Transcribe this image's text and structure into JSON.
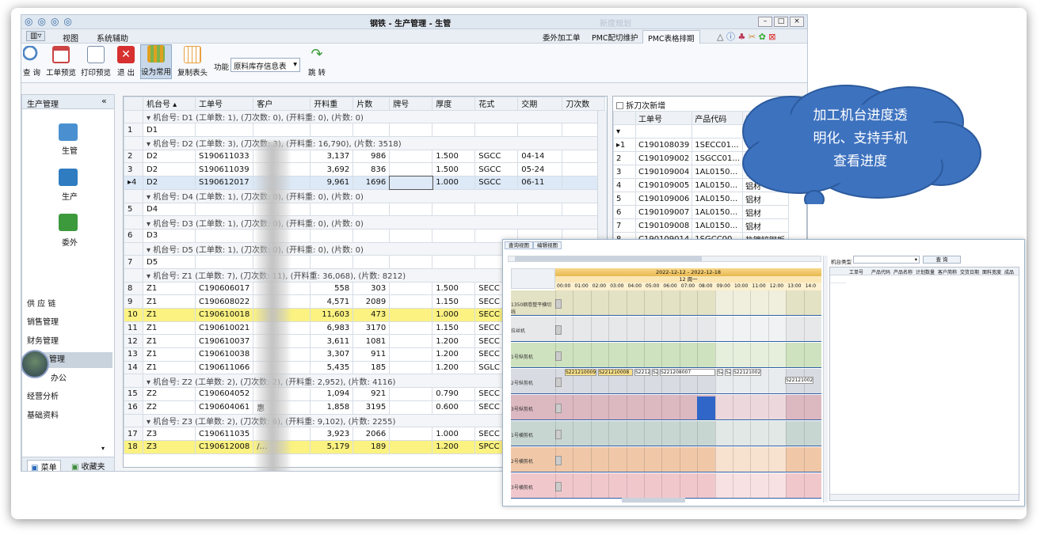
{
  "window": {
    "title": "钢铁 - 生产管理 - 生管",
    "faded_title": "新度规划"
  },
  "menu": {
    "items": [
      "视图",
      "系统辅助"
    ],
    "tabs": [
      "委外加工单",
      "PMC配切维护",
      "PMC表格排期"
    ],
    "active_tab": "PMC表格排期"
  },
  "ribbon": {
    "buttons": [
      "查 询",
      "工单预览",
      "打印预览",
      "退 出",
      "设为常用",
      "复制表头"
    ],
    "function_label": "功能",
    "function_value": "原料库存信息表",
    "jump_label": "跳 转"
  },
  "leftnav": {
    "header": "生产管理",
    "modules": [
      "生管",
      "生产",
      "委外"
    ],
    "items": [
      "供 应 链",
      "销售管理",
      "财务管理",
      "管理",
      "办公",
      "经营分析",
      "基础资料"
    ],
    "bottom_tabs": [
      "菜单",
      "收藏夹"
    ]
  },
  "grid": {
    "columns": [
      "机台号",
      "工单号",
      "客户",
      "开料重",
      "片数",
      "牌号",
      "厚度",
      "花式",
      "交期",
      "刀次数"
    ],
    "rows": [
      {
        "type": "group",
        "text": "机台号: D1 (工单数: 1), (刀次数: 0), (开料重: 0), (片数: 0)"
      },
      {
        "type": "row",
        "n": "1",
        "cells": [
          "D1",
          "",
          "",
          "",
          "",
          "",
          "",
          "",
          "",
          ""
        ]
      },
      {
        "type": "group",
        "text": "机台号: D2 (工单数: 3), (刀次数: 3), (开料重: 16,790), (片数: 3518)"
      },
      {
        "type": "row",
        "n": "2",
        "cells": [
          "D2",
          "S190611033",
          "",
          "3,137",
          "986",
          "",
          "1.500",
          "SGCC",
          "04-14",
          ""
        ]
      },
      {
        "type": "row",
        "n": "3",
        "cells": [
          "D2",
          "S190611039",
          "",
          "3,692",
          "836",
          "",
          "1.500",
          "SGCC",
          "05-24",
          ""
        ]
      },
      {
        "type": "sel",
        "n": "4",
        "cells": [
          "D2",
          "S190612017",
          "",
          "9,961",
          "1696",
          "",
          "1.000",
          "SGCC",
          "06-11",
          ""
        ]
      },
      {
        "type": "group",
        "text": "机台号: D4 (工单数: 1), (刀次数: 0), (开料重: 0), (片数: 0)"
      },
      {
        "type": "row",
        "n": "5",
        "cells": [
          "D4",
          "",
          "",
          "",
          "",
          "",
          "",
          "",
          "",
          ""
        ]
      },
      {
        "type": "group",
        "text": "机台号: D3 (工单数: 1), (刀次数: 0), (开料重: 0), (片数: 0)"
      },
      {
        "type": "row",
        "n": "6",
        "cells": [
          "D3",
          "",
          "",
          "",
          "",
          "",
          "",
          "",
          "",
          ""
        ]
      },
      {
        "type": "group",
        "text": "机台号: D5 (工单数: 1), (刀次数: 0), (开料重: 0), (片数: 0)"
      },
      {
        "type": "row",
        "n": "7",
        "cells": [
          "D5",
          "",
          "",
          "",
          "",
          "",
          "",
          "",
          "",
          ""
        ]
      },
      {
        "type": "group",
        "text": "机台号: Z1 (工单数: 7), (刀次数: 11), (开料重: 36,068), (片数: 8212)"
      },
      {
        "type": "row",
        "n": "8",
        "cells": [
          "Z1",
          "C190606017",
          "",
          "558",
          "303",
          "",
          "1.500",
          "SECC",
          "",
          ""
        ]
      },
      {
        "type": "row",
        "n": "9",
        "cells": [
          "Z1",
          "C190608022",
          "",
          "4,571",
          "2089",
          "",
          "1.150",
          "SECC",
          "",
          ""
        ]
      },
      {
        "type": "hl",
        "n": "10",
        "cells": [
          "Z1",
          "C190610018",
          "",
          "11,603",
          "473",
          "",
          "1.000",
          "SECC",
          "",
          ""
        ]
      },
      {
        "type": "row",
        "n": "11",
        "cells": [
          "Z1",
          "C190610021",
          "",
          "6,983",
          "3170",
          "",
          "1.150",
          "SECC",
          "",
          ""
        ]
      },
      {
        "type": "row",
        "n": "12",
        "cells": [
          "Z1",
          "C190610037",
          "",
          "3,611",
          "1081",
          "",
          "1.200",
          "SECC",
          "",
          ""
        ]
      },
      {
        "type": "row",
        "n": "13",
        "cells": [
          "Z1",
          "C190610038",
          "",
          "3,307",
          "911",
          "",
          "1.200",
          "SECC",
          "",
          ""
        ]
      },
      {
        "type": "row",
        "n": "14",
        "cells": [
          "Z1",
          "C190611066",
          "",
          "5,435",
          "185",
          "",
          "1.200",
          "SGLC",
          "",
          ""
        ]
      },
      {
        "type": "group",
        "text": "机台号: Z2 (工单数: 2), (刀次数: 2), (开料重: 2,952), (片数: 4116)"
      },
      {
        "type": "row",
        "n": "15",
        "cells": [
          "Z2",
          "C190604052",
          "",
          "1,094",
          "921",
          "",
          "0.790",
          "SECC",
          "",
          ""
        ]
      },
      {
        "type": "row",
        "n": "16",
        "cells": [
          "Z2",
          "C190604061",
          "惠",
          "1,858",
          "3195",
          "",
          "0.600",
          "SECC",
          "",
          ""
        ]
      },
      {
        "type": "group",
        "text": "机台号: Z3 (工单数: 2), (刀次数: 6), (开料重: 9,102), (片数: 2255)"
      },
      {
        "type": "row",
        "n": "17",
        "cells": [
          "Z3",
          "C190611035",
          "",
          "3,923",
          "2066",
          "",
          "1.000",
          "SECC",
          "",
          ""
        ]
      },
      {
        "type": "hl",
        "n": "18",
        "cells": [
          "Z3",
          "C190612008",
          "/...",
          "5,179",
          "189",
          "",
          "1.200",
          "SPCC",
          "",
          ""
        ]
      }
    ]
  },
  "right_grid": {
    "checkbox_label": "拆刀次新增",
    "columns": [
      "工单号",
      "产品代码",
      "产品名"
    ],
    "rows": [
      [
        "1",
        "C190108039",
        "1SECC01...",
        ""
      ],
      [
        "2",
        "C190109002",
        "1SGCC01...",
        "热"
      ],
      [
        "3",
        "C190109004",
        "1AL0150...",
        "铝"
      ],
      [
        "4",
        "C190109005",
        "1AL0150...",
        "铝材"
      ],
      [
        "5",
        "C190109006",
        "1AL0150...",
        "铝材"
      ],
      [
        "6",
        "C190109007",
        "1AL0150...",
        "铝材"
      ],
      [
        "7",
        "C190109008",
        "1AL0150...",
        "铝材"
      ],
      [
        "8",
        "C190109014",
        "1SGCC00...",
        "热镀锌钢板"
      ]
    ]
  },
  "cloud": {
    "text_lines": [
      "加工机台进度透",
      "明化、支持手机",
      "查看进度"
    ],
    "color": "#3d72bf"
  },
  "schedule": {
    "tabs": [
      "查询视图",
      "编辑视图"
    ],
    "date_range": "2022-12-12 - 2022-12-18",
    "day": "12 周一",
    "hours": [
      "00:00",
      "01:00",
      "02:00",
      "03:00",
      "04:00",
      "05:00",
      "06:00",
      "07:00",
      "08:00",
      "09:00",
      "10:00",
      "11:00",
      "12:00",
      "13:00",
      "14:0"
    ],
    "lanes": [
      "1350纲卷整平横切线",
      "拉丝机",
      "1号纵剪机",
      "2号纵剪机",
      "3号纵剪机",
      "1号横剪机",
      "2号横剪机",
      "3号横剪机"
    ],
    "lane2_jobs": [
      "S221210009",
      "S221210008",
      "S22121",
      "S2",
      "S221208007",
      "S2",
      "S2",
      "S221210021",
      "S221210021",
      "S221210024"
    ],
    "side_label": "机台类型",
    "query_button": "查 询",
    "side_columns": [
      "工单号",
      "产品代码",
      "产品名称",
      "计划数量",
      "客户简称",
      "交货日期",
      "面料宽度",
      "成品"
    ]
  }
}
